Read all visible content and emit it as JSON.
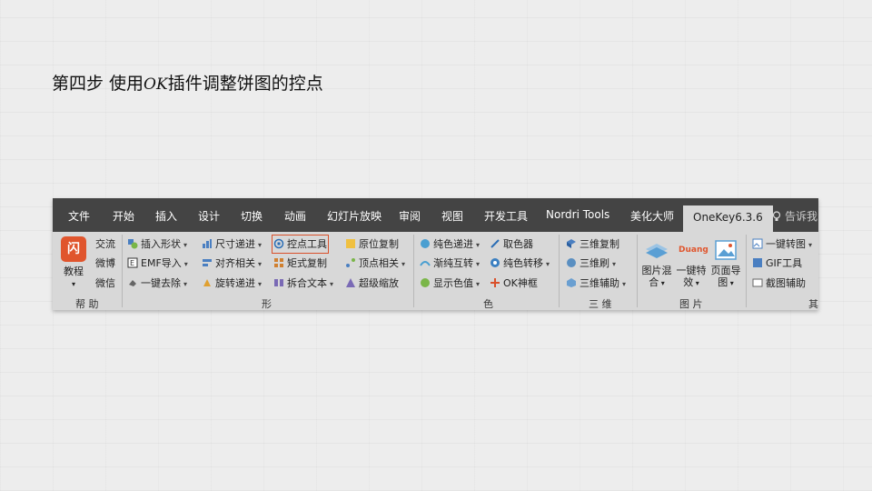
{
  "slide": {
    "title_part1": "第四步  使用",
    "title_ok": "OK",
    "title_part2": "插件调整饼图的控点"
  },
  "tabs": [
    "文件",
    "开始",
    "插入",
    "设计",
    "切换",
    "动画",
    "幻灯片放映",
    "审阅",
    "视图",
    "开发工具",
    "Nordri Tools",
    "美化大师",
    "OneKey6.3.6"
  ],
  "tell_me": "告诉我",
  "groups": {
    "help": {
      "label": "帮 助",
      "big_button": "教程",
      "tutorial_icon_glyph": "闪",
      "items": [
        "交流",
        "微博",
        "微信"
      ]
    },
    "shape": {
      "label": "形",
      "items": [
        "插入形状",
        "EMF导入",
        "一键去除",
        "尺寸递进",
        "对齐相关",
        "旋转递进",
        "控点工具",
        "矩式复制",
        "拆合文本",
        "原位复制",
        "顶点相关",
        "超级缩放"
      ]
    },
    "color": {
      "label": "色",
      "items": [
        "纯色递进",
        "渐纯互转",
        "显示色值",
        "取色器",
        "纯色转移",
        "OK神框"
      ]
    },
    "threed": {
      "label": "三 维",
      "items": [
        "三维复制",
        "三维刷",
        "三维辅助"
      ]
    },
    "picture": {
      "label": "图 片",
      "big_buttons": [
        {
          "line1": "图片混",
          "line2": "合"
        },
        {
          "line1": "一键特",
          "line2": "效"
        },
        {
          "line1": "页面导",
          "line2": "图"
        }
      ],
      "duang_text": "Duang"
    },
    "other": {
      "label": "其",
      "items": [
        "一键转图",
        "GIF工具",
        "截图辅助"
      ]
    }
  },
  "colors": {
    "tabbar_bg": "#444444",
    "ribbon_bg": "#d8d8d8",
    "highlight": "#d9502a",
    "tutorial_icon": "#e0552d"
  }
}
